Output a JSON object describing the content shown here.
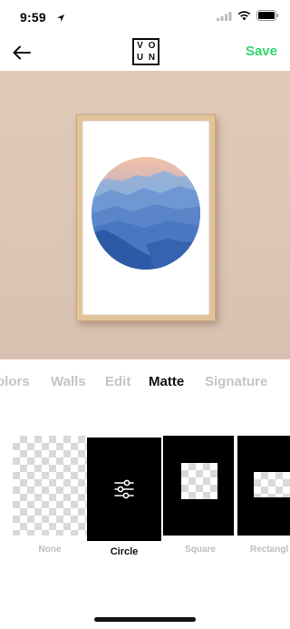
{
  "status_bar": {
    "time": "9:59"
  },
  "nav": {
    "logo_letters": [
      "V",
      "O",
      "U",
      "N"
    ],
    "save_label": "Save"
  },
  "colors": {
    "accent": "#2fd86e",
    "wall": "#dec6b6",
    "frame_wood": "#e2c49b"
  },
  "tabs": [
    {
      "label": "olors",
      "active": false
    },
    {
      "label": "Walls",
      "active": false
    },
    {
      "label": "Edit",
      "active": false
    },
    {
      "label": "Matte",
      "active": true
    },
    {
      "label": "Signature",
      "active": false
    }
  ],
  "matte_options": [
    {
      "label": "None",
      "selected": false
    },
    {
      "label": "Circle",
      "selected": true,
      "icon": "sliders-icon"
    },
    {
      "label": "Square",
      "selected": false
    },
    {
      "label": "Rectangl",
      "selected": false
    }
  ]
}
